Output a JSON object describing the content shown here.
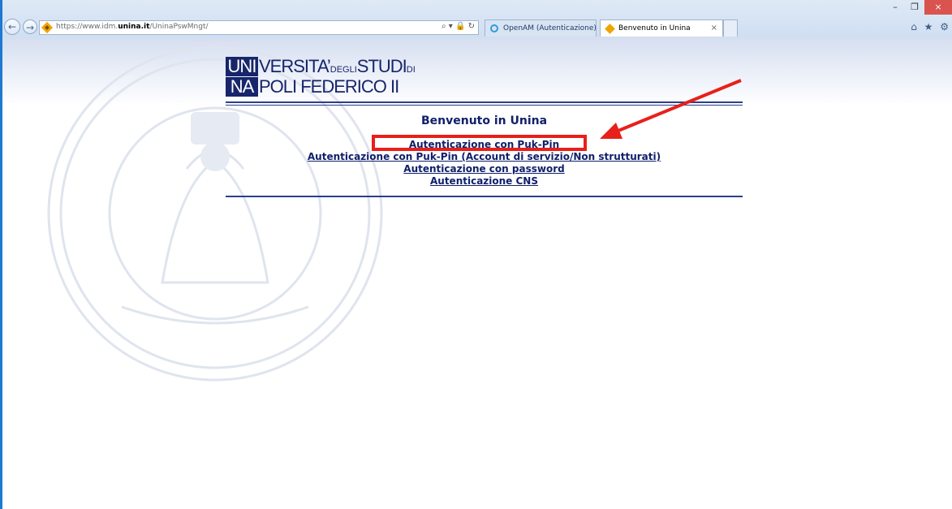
{
  "browser": {
    "url_prefix": "https://www.idm.",
    "url_host": "unina.it",
    "url_path": "/UninaPswMngt/",
    "address_tools": "⌕ ▾ 🔒 ↻",
    "tabs": [
      {
        "label": "OpenAM (Autenticazione)"
      },
      {
        "label": "Benvenuto in Unina",
        "close": "×"
      }
    ],
    "window_controls": {
      "minimize": "–",
      "restore": "❐",
      "close": "×"
    },
    "tool_icons": {
      "home": "⌂",
      "favorites": "★",
      "settings": "⚙"
    },
    "nav": {
      "back": "←",
      "forward": "→"
    }
  },
  "logo": {
    "line1_box": "UNI",
    "line1_text": "VERSITA’",
    "line1_small": "DEGLI",
    "line1_text2": "STUDI",
    "line1_small2": "DI",
    "line2_box": "NA",
    "line2_text": "POLI FEDERICO II"
  },
  "page": {
    "title": "Benvenuto in Unina",
    "links": [
      "Autenticazione con Puk-Pin",
      "Autenticazione con Puk-Pin (Account di servizio/Non strutturati)",
      "Autenticazione con password",
      "Autenticazione CNS"
    ]
  },
  "annotation": {
    "color": "#e8201a"
  },
  "colors": {
    "brand": "#17256b",
    "link": "#10206a",
    "rule": "#2b3f8c"
  }
}
